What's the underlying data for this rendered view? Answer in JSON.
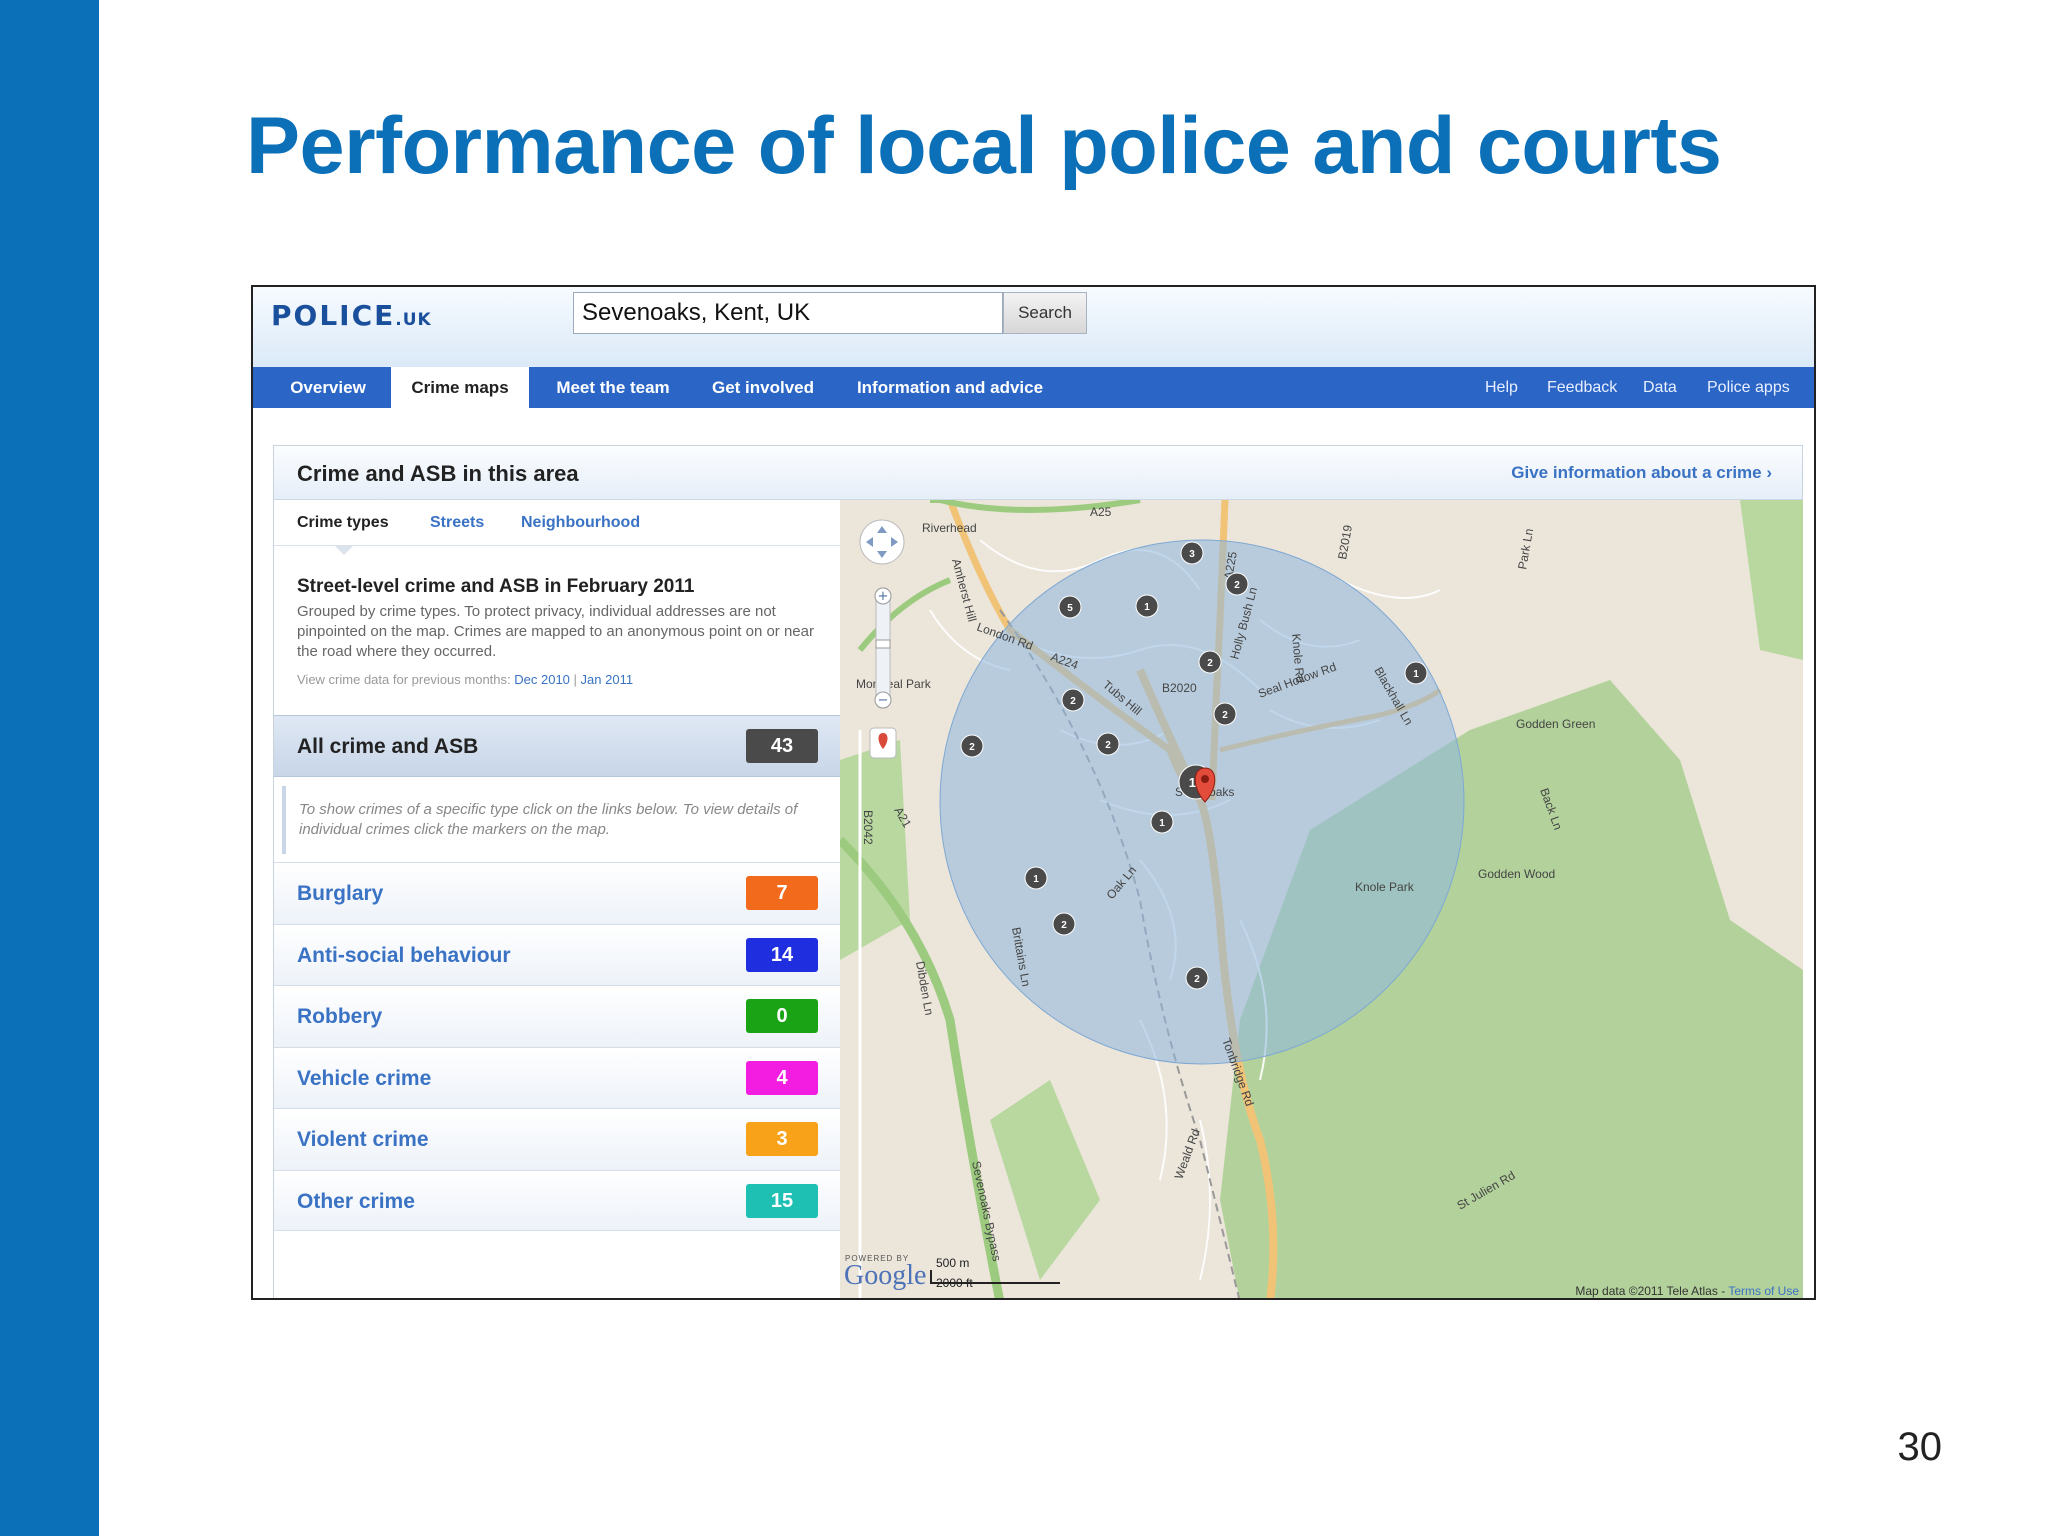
{
  "slide": {
    "title": "Performance of local police and courts",
    "page_number": "30"
  },
  "site": {
    "logo_main": "POLICE",
    "logo_suffix": ".UK",
    "search": {
      "value": "Sevenoaks, Kent, UK",
      "button": "Search"
    },
    "nav": {
      "tabs": [
        "Overview",
        "Crime maps",
        "Meet the team",
        "Get involved",
        "Information and advice"
      ],
      "active": "Crime maps",
      "right_links": [
        "Help",
        "Feedback",
        "Data",
        "Police apps"
      ]
    }
  },
  "content": {
    "title": "Crime and ASB in this area",
    "give_info_link": "Give information about a crime ›",
    "subtabs": [
      "Crime types",
      "Streets",
      "Neighbourhood"
    ],
    "info_heading": "Street-level crime and ASB in February 2011",
    "info_text": "Grouped by crime types. To protect privacy, individual addresses are not pinpointed on the map. Crimes are mapped to an anonymous point on or near the road where they occurred.",
    "prev_months_label": "View crime data for previous months:",
    "prev_months": [
      "Dec 2010",
      "Jan 2011"
    ],
    "all_crime": {
      "label": "All crime and ASB",
      "count": "43"
    },
    "crime_note": "To show crimes of a specific type click on the links below. To view details of individual crimes click the markers on the map.",
    "crime_types": [
      {
        "label": "Burglary",
        "count": "7",
        "color": "#f26a1b"
      },
      {
        "label": "Anti-social behaviour",
        "count": "14",
        "color": "#1f2fe0"
      },
      {
        "label": "Robbery",
        "count": "0",
        "color": "#1aa315"
      },
      {
        "label": "Vehicle crime",
        "count": "4",
        "color": "#f21de0"
      },
      {
        "label": "Violent crime",
        "count": "3",
        "color": "#f7a218"
      },
      {
        "label": "Other crime",
        "count": "15",
        "color": "#1ec0b4"
      }
    ]
  },
  "map": {
    "place_labels": [
      "Riverhead",
      "Sevenoaks",
      "Knole Park",
      "Godden Green",
      "Godden Wood",
      "Montreal Park"
    ],
    "road_labels": [
      "A25",
      "A224",
      "A225",
      "B2019",
      "B2020",
      "B2042",
      "A21",
      "London Rd",
      "Tubs Hill",
      "Seal Hollow Rd",
      "Amherst Hill",
      "Sevenoaks Bypass",
      "Tonbridge Rd",
      "Oak Ln",
      "Blackhall Ln",
      "Park Ln",
      "Back Ln",
      "St Julien Rd",
      "Dibden Ln",
      "Brittains Ln",
      "Holly Bush Ln",
      "Weald Rd",
      "Knole Rd"
    ],
    "cluster_markers": [
      "3",
      "2",
      "5",
      "1",
      "2",
      "1",
      "2",
      "2",
      "2",
      "2",
      "15",
      "1",
      "1",
      "2",
      "2"
    ],
    "powered_by": "POWERED BY",
    "google": "Google",
    "scale_metric": "500 m",
    "scale_imperial": "2000 ft",
    "attribution": "Map data ©2011 Tele Atlas -",
    "terms": "Terms of Use"
  }
}
